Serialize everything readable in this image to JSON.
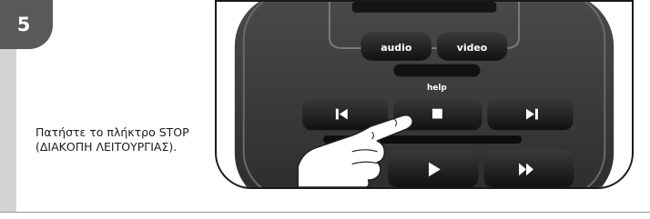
{
  "step": {
    "number": "5"
  },
  "instruction": {
    "text": "Πατήστε το πλήκτρο STOP (ΔΙΑΚΟΠΗ ΛΕΙΤΟΥΡΓΙΑΣ)."
  },
  "remote": {
    "audio_label": "audio",
    "video_label": "video",
    "help_label": "help",
    "transport_icons": [
      "skip-back-icon",
      "stop-icon",
      "skip-forward-icon",
      "play-icon",
      "fast-forward-icon"
    ]
  }
}
